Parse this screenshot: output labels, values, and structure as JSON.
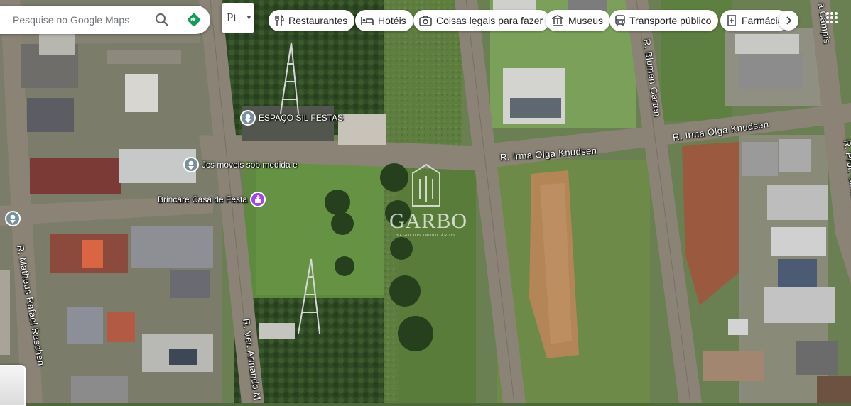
{
  "search": {
    "placeholder": "Pesquise no Google Maps"
  },
  "translate_button": {
    "label": "Pt"
  },
  "chips": [
    {
      "label": "Restaurantes",
      "icon": "fork-knife-icon"
    },
    {
      "label": "Hotéis",
      "icon": "bed-icon"
    },
    {
      "label": "Coisas legais para fazer",
      "icon": "camera-icon"
    },
    {
      "label": "Museus",
      "icon": "museum-icon"
    },
    {
      "label": "Transporte público",
      "icon": "bus-icon"
    },
    {
      "label": "Farmácia",
      "icon": "pharmacy-icon"
    }
  ],
  "places": [
    {
      "label": "ESPAÇO SIL FESTAS"
    },
    {
      "label": "Jcs moveis sob medida e"
    },
    {
      "label": "Brincare Casa de Festa"
    }
  ],
  "streets": [
    {
      "label": "R. Irma Olga Knudsen"
    },
    {
      "label": "R. Irma Olga Knudsen"
    },
    {
      "label": "R. Blumen Garten"
    },
    {
      "label": "R. Ver. Armando M"
    },
    {
      "label": "R. Matheus Rafael Raschen"
    },
    {
      "label": "R. Prof. Simão H. a Campis"
    },
    {
      "label": "a Campis"
    }
  ],
  "watermark": {
    "name": "GARBO",
    "sub": "NEGÓCIOS IMOBILIÁRIOS"
  },
  "colors": {
    "accent": "#1a73e8",
    "direction": "#0f9d58",
    "place_pin": "#78909c",
    "party_pin": "#a142f4"
  }
}
